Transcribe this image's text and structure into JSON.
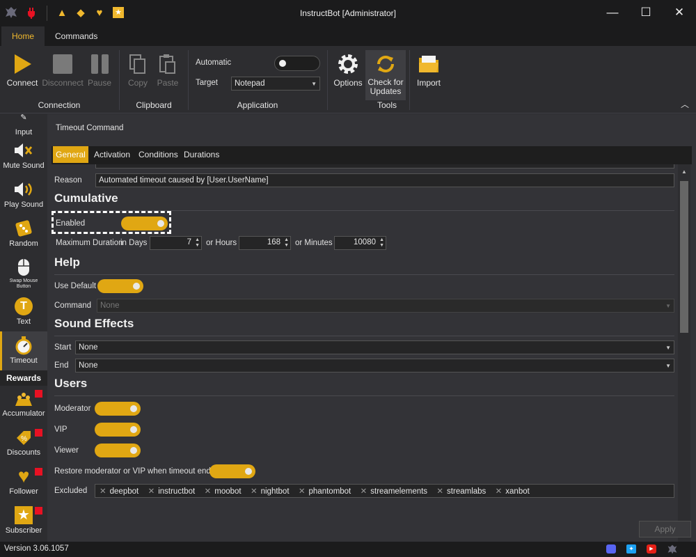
{
  "window": {
    "title": "InstructBot [Administrator]"
  },
  "quick_icons": [
    "dragon-logo-icon",
    "plug-icon",
    "accumulator-icon",
    "discount-icon",
    "follower-heart-icon",
    "subscriber-star-icon"
  ],
  "ribbon_tabs": [
    {
      "label": "Home",
      "active": true
    },
    {
      "label": "Commands",
      "active": false
    }
  ],
  "ribbon": {
    "connection": {
      "label": "Connection",
      "buttons": [
        "Connect",
        "Disconnect",
        "Pause"
      ]
    },
    "clipboard": {
      "label": "Clipboard",
      "buttons": [
        "Copy",
        "Paste"
      ]
    },
    "application": {
      "label": "Application",
      "automatic_label": "Automatic",
      "automatic_on": false,
      "target_label": "Target",
      "target_value": "Notepad"
    },
    "tools": {
      "label": "Tools",
      "buttons": [
        "Options",
        "Check for",
        "Updates"
      ]
    },
    "import": "Import"
  },
  "sidebar": {
    "items": [
      "Input",
      "Mute Sound",
      "Play Sound",
      "Random",
      "Swap Mouse",
      "Button",
      "Text",
      "Timeout"
    ],
    "rewards_header": "Rewards",
    "rewards": [
      "Accumulator",
      "Discounts",
      "Follower",
      "Subscriber"
    ]
  },
  "main": {
    "title": "Timeout Command",
    "tabs": [
      "General",
      "Activation",
      "Conditions",
      "Durations"
    ],
    "reason_label": "Reason",
    "reason_value": "Automated timeout caused by [User.UserName]",
    "cumulative": {
      "heading": "Cumulative",
      "enabled_label": "Enabled",
      "enabled": true,
      "max_label": "Maximum Duration",
      "days_label": "in Days",
      "days": "7",
      "hours_label": "or Hours",
      "hours": "168",
      "minutes_label": "or Minutes",
      "minutes": "10080"
    },
    "help": {
      "heading": "Help",
      "use_default_label": "Use Default",
      "use_default": true,
      "command_label": "Command",
      "command_value": "None"
    },
    "sound": {
      "heading": "Sound Effects",
      "start_label": "Start",
      "start_value": "None",
      "end_label": "End",
      "end_value": "None"
    },
    "users": {
      "heading": "Users",
      "moderator_label": "Moderator",
      "vip_label": "VIP",
      "viewer_label": "Viewer",
      "restore_label": "Restore moderator or VIP when timeout ends",
      "excluded_label": "Excluded",
      "excluded": [
        "deepbot",
        "instructbot",
        "moobot",
        "nightbot",
        "phantombot",
        "streamelements",
        "streamlabs",
        "xanbot"
      ]
    },
    "apply_label": "Apply"
  },
  "status": {
    "version": "Version 3.06.1057",
    "icons": [
      "discord-icon",
      "twitter-icon",
      "youtube-icon",
      "dragon-logo-icon"
    ]
  },
  "colors": {
    "accent": "#e0a713",
    "background": "#2d2d30",
    "titlebar": "#1b1b1c"
  }
}
